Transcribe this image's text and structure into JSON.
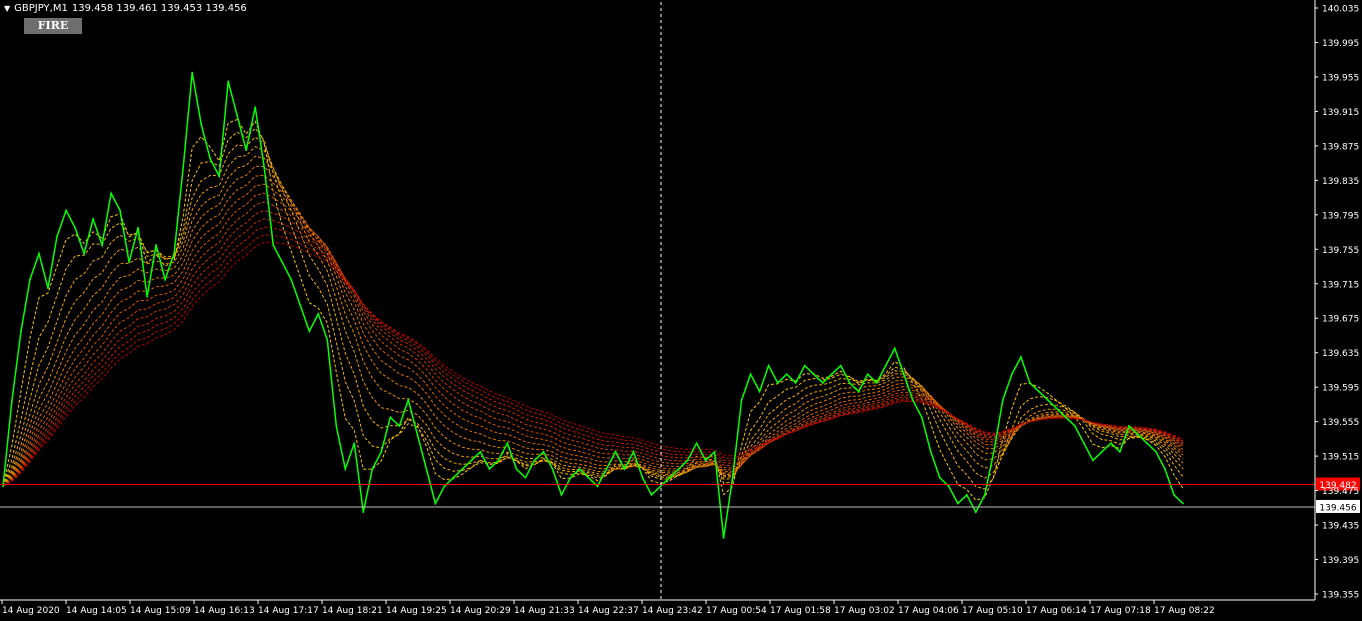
{
  "header": {
    "symbol": "GBPJPY,M1",
    "ohlc": "139.458 139.461 139.453 139.456",
    "fire_label": "FIRE"
  },
  "colors": {
    "background": "#000000",
    "axis": "#ffffff",
    "price": "#00ff00",
    "ma_fast": "#ffd700",
    "ma_slow": "#b40000",
    "level_line": "#ff0000",
    "bid_line": "#c0c0c0",
    "crosshair": "#ffffff"
  },
  "chart_data": {
    "type": "line",
    "symbol": "GBPJPY",
    "timeframe": "M1",
    "y_ticks": [
      "140.035",
      "139.995",
      "139.955",
      "139.915",
      "139.875",
      "139.835",
      "139.795",
      "139.755",
      "139.715",
      "139.675",
      "139.635",
      "139.595",
      "139.555",
      "139.515",
      "139.475",
      "139.435",
      "139.395",
      "139.355"
    ],
    "ylim": [
      139.355,
      140.035
    ],
    "x_ticks": [
      "14 Aug 2020",
      "14 Aug 14:05",
      "14 Aug 15:09",
      "14 Aug 16:13",
      "14 Aug 17:17",
      "14 Aug 18:21",
      "14 Aug 19:25",
      "14 Aug 20:29",
      "14 Aug 21:33",
      "14 Aug 22:37",
      "14 Aug 23:42",
      "17 Aug 00:54",
      "17 Aug 01:58",
      "17 Aug 03:02",
      "17 Aug 04:06",
      "17 Aug 05:10",
      "17 Aug 06:14",
      "17 Aug 07:18",
      "17 Aug 08:22"
    ],
    "horizontal_levels": [
      {
        "label": "139.482",
        "value": 139.482,
        "color": "#ff0000"
      },
      {
        "label": "139.456",
        "value": 139.456,
        "color": "#c0c0c0"
      }
    ],
    "crosshair_x_index": 10,
    "ma_ribbon": {
      "count": 16,
      "periods_from": 10,
      "periods_to": 160
    },
    "series": [
      {
        "values": [
          [
            0,
            139.48
          ],
          [
            1,
            139.58
          ],
          [
            2,
            139.66
          ],
          [
            3,
            139.72
          ],
          [
            4,
            139.75
          ],
          [
            5,
            139.71
          ],
          [
            6,
            139.77
          ],
          [
            7,
            139.8
          ],
          [
            8,
            139.78
          ],
          [
            9,
            139.75
          ],
          [
            10,
            139.79
          ],
          [
            11,
            139.76
          ],
          [
            12,
            139.82
          ],
          [
            13,
            139.8
          ],
          [
            14,
            139.74
          ],
          [
            15,
            139.78
          ],
          [
            16,
            139.7
          ],
          [
            17,
            139.76
          ],
          [
            18,
            139.72
          ],
          [
            19,
            139.75
          ],
          [
            20,
            139.85
          ],
          [
            21,
            139.96
          ],
          [
            22,
            139.9
          ],
          [
            23,
            139.86
          ],
          [
            24,
            139.84
          ],
          [
            25,
            139.95
          ],
          [
            26,
            139.91
          ],
          [
            27,
            139.87
          ],
          [
            28,
            139.92
          ],
          [
            29,
            139.85
          ],
          [
            30,
            139.76
          ],
          [
            31,
            139.74
          ],
          [
            32,
            139.72
          ],
          [
            33,
            139.69
          ],
          [
            34,
            139.66
          ],
          [
            35,
            139.68
          ],
          [
            36,
            139.65
          ],
          [
            37,
            139.55
          ],
          [
            38,
            139.5
          ],
          [
            39,
            139.53
          ],
          [
            40,
            139.45
          ],
          [
            41,
            139.5
          ],
          [
            42,
            139.52
          ],
          [
            43,
            139.56
          ],
          [
            44,
            139.55
          ],
          [
            45,
            139.58
          ],
          [
            46,
            139.54
          ],
          [
            47,
            139.5
          ],
          [
            48,
            139.46
          ],
          [
            49,
            139.48
          ],
          [
            50,
            139.49
          ],
          [
            51,
            139.5
          ],
          [
            52,
            139.51
          ],
          [
            53,
            139.52
          ],
          [
            54,
            139.5
          ],
          [
            55,
            139.51
          ],
          [
            56,
            139.53
          ],
          [
            57,
            139.5
          ],
          [
            58,
            139.49
          ],
          [
            59,
            139.51
          ],
          [
            60,
            139.52
          ],
          [
            61,
            139.5
          ],
          [
            62,
            139.47
          ],
          [
            63,
            139.49
          ],
          [
            64,
            139.5
          ],
          [
            65,
            139.49
          ],
          [
            66,
            139.48
          ],
          [
            67,
            139.5
          ],
          [
            68,
            139.52
          ],
          [
            69,
            139.5
          ],
          [
            70,
            139.52
          ],
          [
            71,
            139.49
          ],
          [
            72,
            139.47
          ],
          [
            73,
            139.48
          ],
          [
            74,
            139.49
          ],
          [
            75,
            139.5
          ],
          [
            76,
            139.51
          ],
          [
            77,
            139.53
          ],
          [
            78,
            139.51
          ],
          [
            79,
            139.52
          ],
          [
            80,
            139.42
          ],
          [
            81,
            139.49
          ],
          [
            82,
            139.58
          ],
          [
            83,
            139.61
          ],
          [
            84,
            139.59
          ],
          [
            85,
            139.62
          ],
          [
            86,
            139.6
          ],
          [
            87,
            139.61
          ],
          [
            88,
            139.6
          ],
          [
            89,
            139.62
          ],
          [
            90,
            139.61
          ],
          [
            91,
            139.6
          ],
          [
            92,
            139.61
          ],
          [
            93,
            139.62
          ],
          [
            94,
            139.6
          ],
          [
            95,
            139.59
          ],
          [
            96,
            139.61
          ],
          [
            97,
            139.6
          ],
          [
            98,
            139.62
          ],
          [
            99,
            139.64
          ],
          [
            100,
            139.61
          ],
          [
            101,
            139.58
          ],
          [
            102,
            139.56
          ],
          [
            103,
            139.52
          ],
          [
            104,
            139.49
          ],
          [
            105,
            139.48
          ],
          [
            106,
            139.46
          ],
          [
            107,
            139.47
          ],
          [
            108,
            139.45
          ],
          [
            109,
            139.47
          ],
          [
            110,
            139.52
          ],
          [
            111,
            139.58
          ],
          [
            112,
            139.61
          ],
          [
            113,
            139.63
          ],
          [
            114,
            139.6
          ],
          [
            115,
            139.59
          ],
          [
            116,
            139.58
          ],
          [
            117,
            139.57
          ],
          [
            118,
            139.56
          ],
          [
            119,
            139.55
          ],
          [
            120,
            139.53
          ],
          [
            121,
            139.51
          ],
          [
            122,
            139.52
          ],
          [
            123,
            139.53
          ],
          [
            124,
            139.52
          ],
          [
            125,
            139.55
          ],
          [
            126,
            139.54
          ],
          [
            127,
            139.53
          ],
          [
            128,
            139.52
          ],
          [
            129,
            139.5
          ],
          [
            130,
            139.47
          ],
          [
            131,
            139.46
          ]
        ]
      }
    ]
  }
}
